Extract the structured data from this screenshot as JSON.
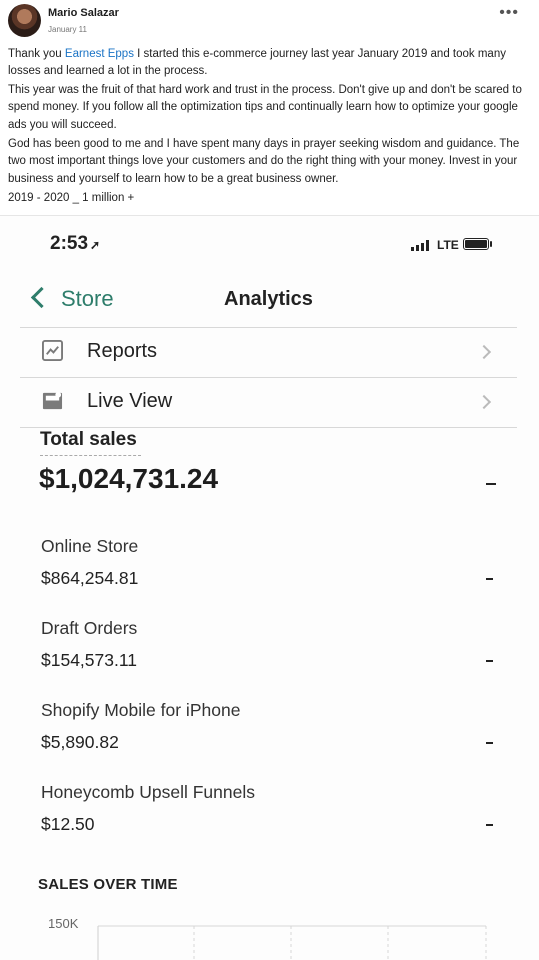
{
  "post": {
    "author": "Mario Salazar",
    "time": "January 11",
    "more_icon": "more-horizontal-icon",
    "para1_prefix": "Thank you ",
    "mention": "Earnest Epps",
    "para1_suffix": " I started this e-commerce journey last year January 2019 and took many losses and learned a lot in the process.",
    "para2": "This year was the fruit of that hard work and trust in the process. Don't give up and don't be scared to spend money. If you follow all the optimization tips and continually learn how to optimize your google ads you will succeed.",
    "para3": "God has been good to me and I have spent many days in prayer seeking wisdom and guidance. The two most important things love your customers and do the right thing with your money. Invest in your business and yourself to learn how to be a great business owner.",
    "para4": "2019 - 2020 _ 1 million +",
    "mention_color": "#1a73c5"
  },
  "phone": {
    "status": {
      "time": "2:53",
      "location_icon": "location-arrow-icon",
      "network": "LTE"
    },
    "nav": {
      "back_label": "Store",
      "title": "Analytics",
      "accent_color": "#2e7d6b"
    },
    "menu": [
      {
        "label": "Reports",
        "icon": "reports-icon"
      },
      {
        "label": "Live View",
        "icon": "live-view-icon"
      }
    ],
    "total": {
      "label": "Total sales",
      "value": "$1,024,731.24",
      "trend": "-"
    },
    "channels": [
      {
        "name": "Online Store",
        "value": "$864,254.81",
        "trend": "-"
      },
      {
        "name": "Draft Orders",
        "value": "$154,573.11",
        "trend": "-"
      },
      {
        "name": "Shopify Mobile for iPhone",
        "value": "$5,890.82",
        "trend": "-"
      },
      {
        "name": "Honeycomb Upsell Funnels",
        "value": "$12.50",
        "trend": "-"
      }
    ],
    "sales_over_time": {
      "title": "SALES OVER TIME",
      "y_tick": "150K"
    }
  }
}
